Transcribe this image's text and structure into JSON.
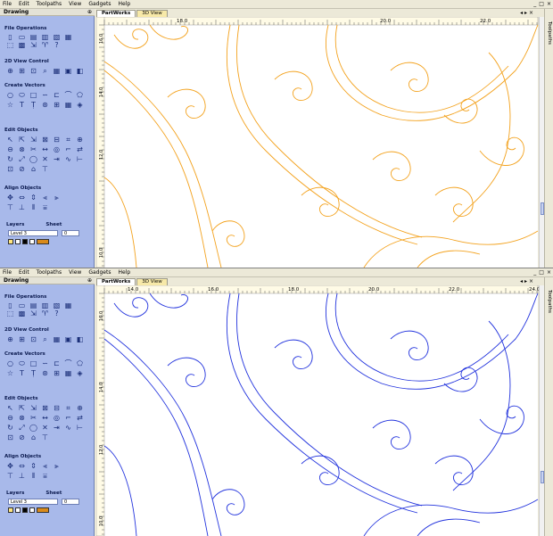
{
  "menu": [
    "File",
    "Edit",
    "Toolpaths",
    "View",
    "Gadgets",
    "Help"
  ],
  "window_controls": [
    "_",
    "□",
    "×"
  ],
  "panel": {
    "title": "Drawing",
    "pin": "⊕",
    "sections": {
      "file": "File Operations",
      "view": "2D View Control",
      "create": "Create Vectors",
      "edit": "Edit Objects",
      "align": "Align Objects"
    },
    "layers_label": "Layers",
    "sheet_label": "Sheet",
    "layer_value": "Level 3",
    "sheet_value": "0"
  },
  "tabs": [
    "PartWorks",
    "3D View"
  ],
  "tab_nav": "◂ ▸ ×",
  "right_panel_label": "Toolpaths",
  "panes": [
    {
      "id": "top",
      "vector_color": "#f3a21e",
      "ruler_h_labels": [
        "18.0",
        "20.0",
        "22.0"
      ],
      "ruler_v_labels": [
        "16.0",
        "14.0",
        "12.0",
        "10.0"
      ]
    },
    {
      "id": "bottom",
      "vector_color": "#2233dd",
      "ruler_h_labels": [
        "14.0",
        "16.0",
        "18.0",
        "20.0",
        "22.0",
        "24.0"
      ],
      "ruler_v_labels": [
        "16.0",
        "14.0",
        "12.0",
        "10.0"
      ]
    }
  ],
  "icons": {
    "file": [
      "new-icon",
      "open-icon",
      "save-icon",
      "import-icon",
      "export-icon",
      "template-icon",
      "select-icon",
      "print-icon",
      "move-icon",
      "gadget-icon",
      "help-icon"
    ],
    "view": [
      "zoom-fit-icon",
      "zoom-in-icon",
      "zoom-box-icon",
      "pan-icon",
      "grid-icon",
      "snap-icon",
      "color-icon"
    ],
    "create": [
      "circle-icon",
      "ellipse-icon",
      "rectangle-icon",
      "polyline-icon",
      "curve-icon",
      "arc-icon",
      "polygon-icon",
      "star-icon",
      "text-icon",
      "text-on-curve-icon",
      "bitmap-icon",
      "array-icon",
      "table-icon",
      "node-icon"
    ],
    "edit": [
      "node-edit-icon",
      "smooth-icon",
      "transform-icon",
      "group-icon",
      "ungroup-icon",
      "join-icon",
      "weld-icon",
      "subtract-icon",
      "intersect-icon",
      "trim-icon",
      "extend-icon",
      "offset-icon",
      "fillet-icon",
      "mirror-icon",
      "rotate-icon",
      "scale-icon",
      "close-icon",
      "cut-icon",
      "fit-icon",
      "spline-icon",
      "measure-icon",
      "layer-icon",
      "hide-icon",
      "lock-icon",
      "align-icon"
    ],
    "align": [
      "align-center-icon",
      "align-h-icon",
      "align-v-icon",
      "align-left-icon",
      "align-right-icon",
      "align-top-icon",
      "align-bottom-icon",
      "space-h-icon",
      "space-v-icon"
    ]
  },
  "glyphs": {
    "file": [
      "▯",
      "▭",
      "▤",
      "▥",
      "▧",
      "▦",
      "⬚",
      "▩",
      "⇲",
      "♈",
      "?"
    ],
    "view": [
      "⊕",
      "⊞",
      "⊡",
      "⌕",
      "▦",
      "▣",
      "◧"
    ],
    "create": [
      "○",
      "⬭",
      "□",
      "∽",
      "⊏",
      "⌒",
      "⬠",
      "☆",
      "T",
      "Ṭ",
      "⊛",
      "⊞",
      "▦",
      "◈"
    ],
    "edit": [
      "↖",
      "⇱",
      "⇲",
      "⊠",
      "⊟",
      "⌗",
      "⊕",
      "⊖",
      "⊗",
      "✂",
      "↔",
      "◎",
      "⌐",
      "⇄",
      "↻",
      "⤢",
      "◯",
      "✕",
      "⇥",
      "∿",
      "⊢",
      "⊡",
      "⊘",
      "⌂",
      "⊤"
    ],
    "align": [
      "✥",
      "⇔",
      "⇕",
      "⫷",
      "⫸",
      "⊤",
      "⊥",
      "⫴",
      "⩸"
    ]
  }
}
